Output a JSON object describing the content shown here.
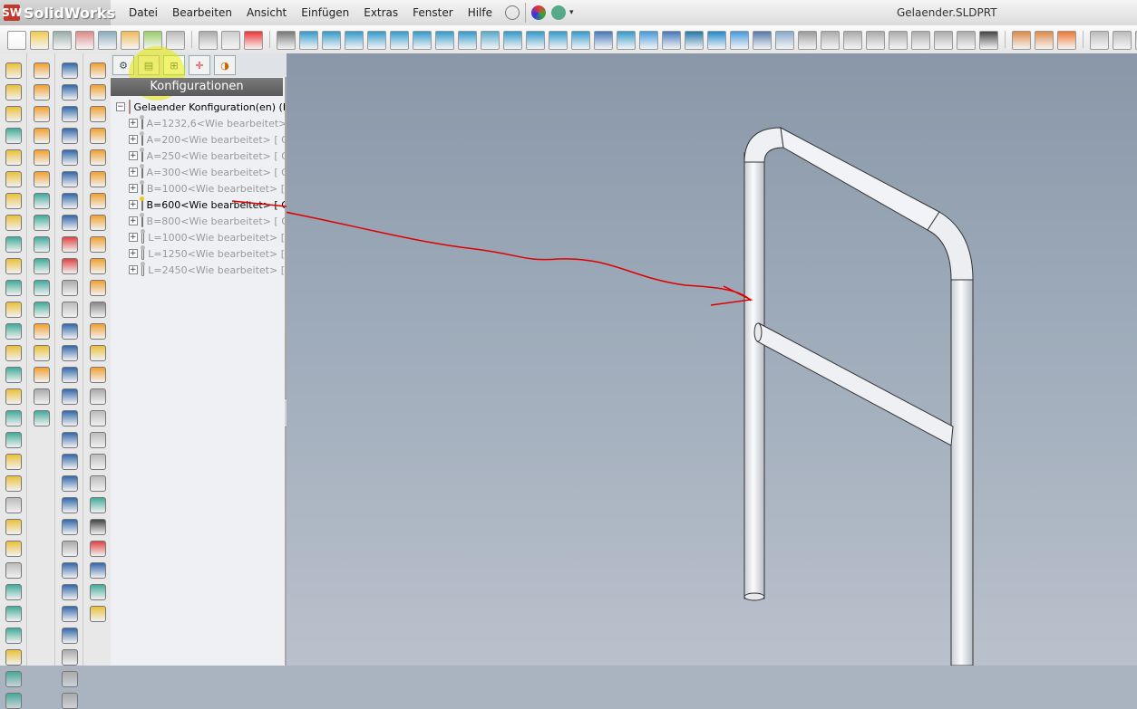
{
  "app": {
    "logo_text": "SolidWorks",
    "logo_mark": "SW"
  },
  "menu": [
    "Datei",
    "Bearbeiten",
    "Ansicht",
    "Einfügen",
    "Extras",
    "Fenster",
    "Hilfe"
  ],
  "document_title": "Gelaender.SLDPRT",
  "panel": {
    "header": "Konfigurationen",
    "root_label": "Gelaender Konfiguration(en)  (B",
    "items": [
      {
        "label": "A=1232,6<Wie bearbeitet>"
      },
      {
        "label": "A=200<Wie bearbeitet> [ G"
      },
      {
        "label": "A=250<Wie bearbeitet> [ G"
      },
      {
        "label": "A=300<Wie bearbeitet> [ G"
      },
      {
        "label": "B=1000<Wie bearbeitet> [ "
      },
      {
        "label": "B=600<Wie bearbeitet> [ G",
        "active": true
      },
      {
        "label": "B=800<Wie bearbeitet> [ G"
      },
      {
        "label": "L=1000<Wie bearbeitet> [ "
      },
      {
        "label": "L=1250<Wie bearbeitet> [ "
      },
      {
        "label": "L=2450<Wie bearbeitet> [ "
      }
    ]
  },
  "colors": {
    "annotation": "#e00000",
    "highlight": "#e8e800"
  },
  "icons": {
    "tabs": [
      "feature-manager-icon",
      "property-manager-icon",
      "configuration-manager-icon",
      "dimxpert-icon",
      "appearance-icon"
    ]
  }
}
